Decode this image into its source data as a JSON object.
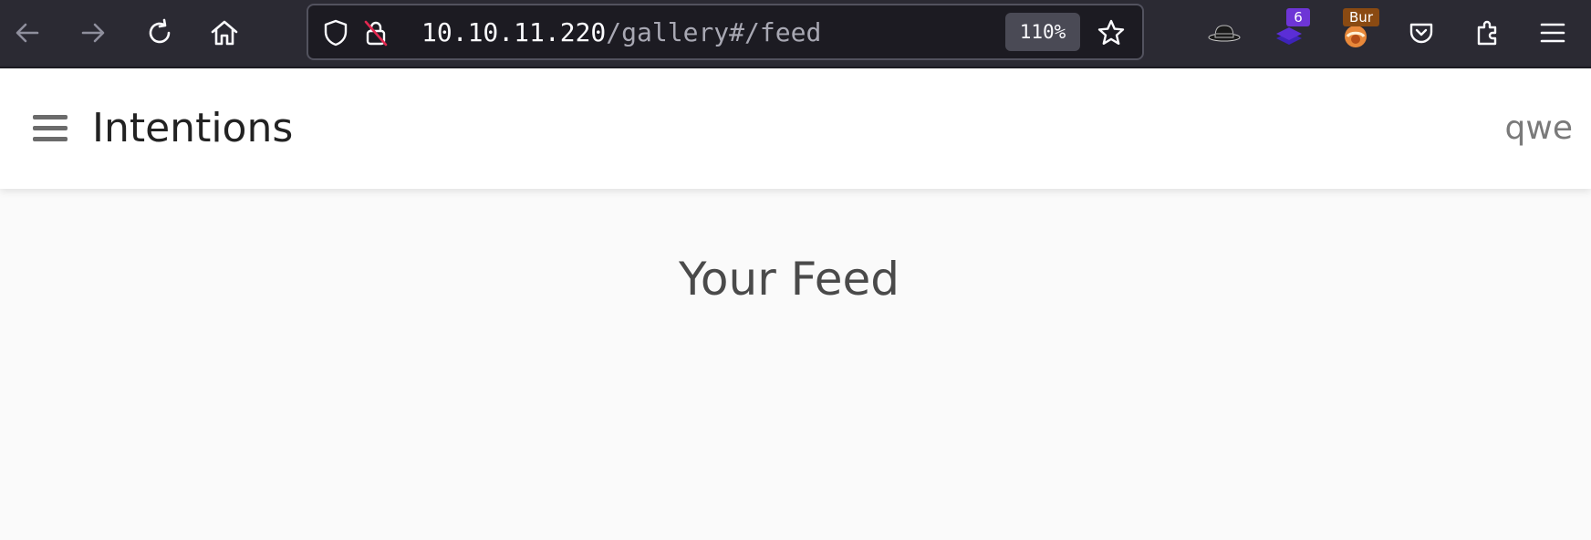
{
  "browser": {
    "url_host": "10.10.11.220",
    "url_path": "/gallery#/feed",
    "zoom": "110%",
    "icons": {
      "back": "back-arrow-icon",
      "forward": "forward-arrow-icon",
      "reload": "reload-icon",
      "home": "home-icon",
      "tracking_protection": "shield-icon",
      "insecure": "insecure-lock-icon",
      "bookmark": "star-icon"
    },
    "extensions": {
      "hat": {
        "icon": "fedora-hat-icon"
      },
      "layers": {
        "icon": "stacked-layers-icon",
        "badge": "6",
        "badge_color": "#6e35d6"
      },
      "burp": {
        "icon": "burp-suite-icon",
        "badge": "Bur",
        "badge_color": "#8a4a12"
      },
      "pocket": {
        "icon": "pocket-icon"
      },
      "extensions": {
        "icon": "puzzle-extensions-icon"
      },
      "menu": {
        "icon": "hamburger-menu-icon"
      }
    },
    "colors": {
      "toolbar": "#2b2a33",
      "urlbar": "#1c1b22"
    }
  },
  "app": {
    "title": "Intentions",
    "user": "qwe",
    "menu_icon": "hamburger-menu-icon"
  },
  "main": {
    "heading": "Your Feed"
  }
}
